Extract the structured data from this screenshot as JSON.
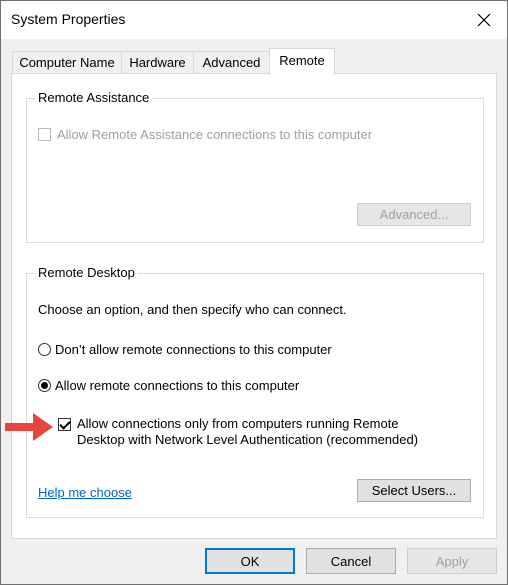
{
  "window": {
    "title": "System Properties"
  },
  "tabs": [
    {
      "label": "Computer Name"
    },
    {
      "label": "Hardware"
    },
    {
      "label": "Advanced"
    },
    {
      "label": "Remote"
    }
  ],
  "active_tab": "Remote",
  "remote_assistance": {
    "legend": "Remote Assistance",
    "allow_label": "Allow Remote Assistance connections to this computer",
    "allow_checked": false,
    "allow_enabled": false,
    "advanced_button": "Advanced..."
  },
  "remote_desktop": {
    "legend": "Remote Desktop",
    "instruction": "Choose an option, and then specify who can connect.",
    "option_dont_allow": "Don’t allow remote connections to this computer",
    "option_allow": "Allow remote connections to this computer",
    "selected_option": "allow",
    "nla_label_line1": "Allow connections only from computers running Remote",
    "nla_label_line2": "Desktop with Network Level Authentication (recommended)",
    "nla_checked": true,
    "help_link": "Help me choose",
    "select_users_button": "Select Users..."
  },
  "footer": {
    "ok": "OK",
    "cancel": "Cancel",
    "apply": "Apply",
    "apply_enabled": false
  },
  "colors": {
    "accent": "#0078d7",
    "link": "#0066cc",
    "arrow": "#e8453c"
  },
  "icons": {
    "close": "close-icon",
    "annotation": "red-arrow-icon"
  }
}
